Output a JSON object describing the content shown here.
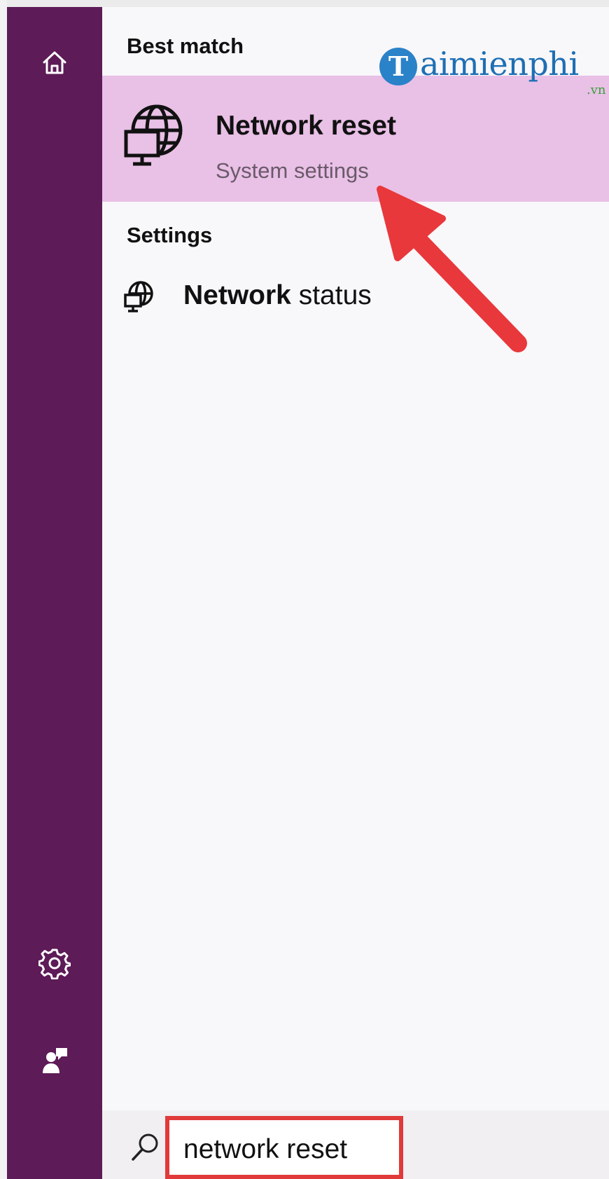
{
  "sidebar": {
    "items": [
      {
        "name": "home",
        "icon": "home-icon"
      },
      {
        "name": "settings",
        "icon": "gear-icon"
      },
      {
        "name": "feedback",
        "icon": "feedback-person-icon"
      }
    ],
    "background": "#5d1b57"
  },
  "results": {
    "best_match_header": "Best match",
    "best_match": {
      "title": "Network reset",
      "subtitle": "System settings",
      "icon": "globe-monitor-icon",
      "highlight_color": "#e9c0e6"
    },
    "settings_header": "Settings",
    "settings_items": [
      {
        "bold": "Network",
        "rest": " status",
        "icon": "globe-monitor-icon"
      }
    ]
  },
  "watermark": {
    "letter": "T",
    "text": "aimienphi",
    "suffix": ".vn"
  },
  "search": {
    "value": "network reset",
    "icon": "search-icon",
    "outline_color": "#e03a3a"
  },
  "annotation": {
    "arrow_color": "#e8383c"
  }
}
